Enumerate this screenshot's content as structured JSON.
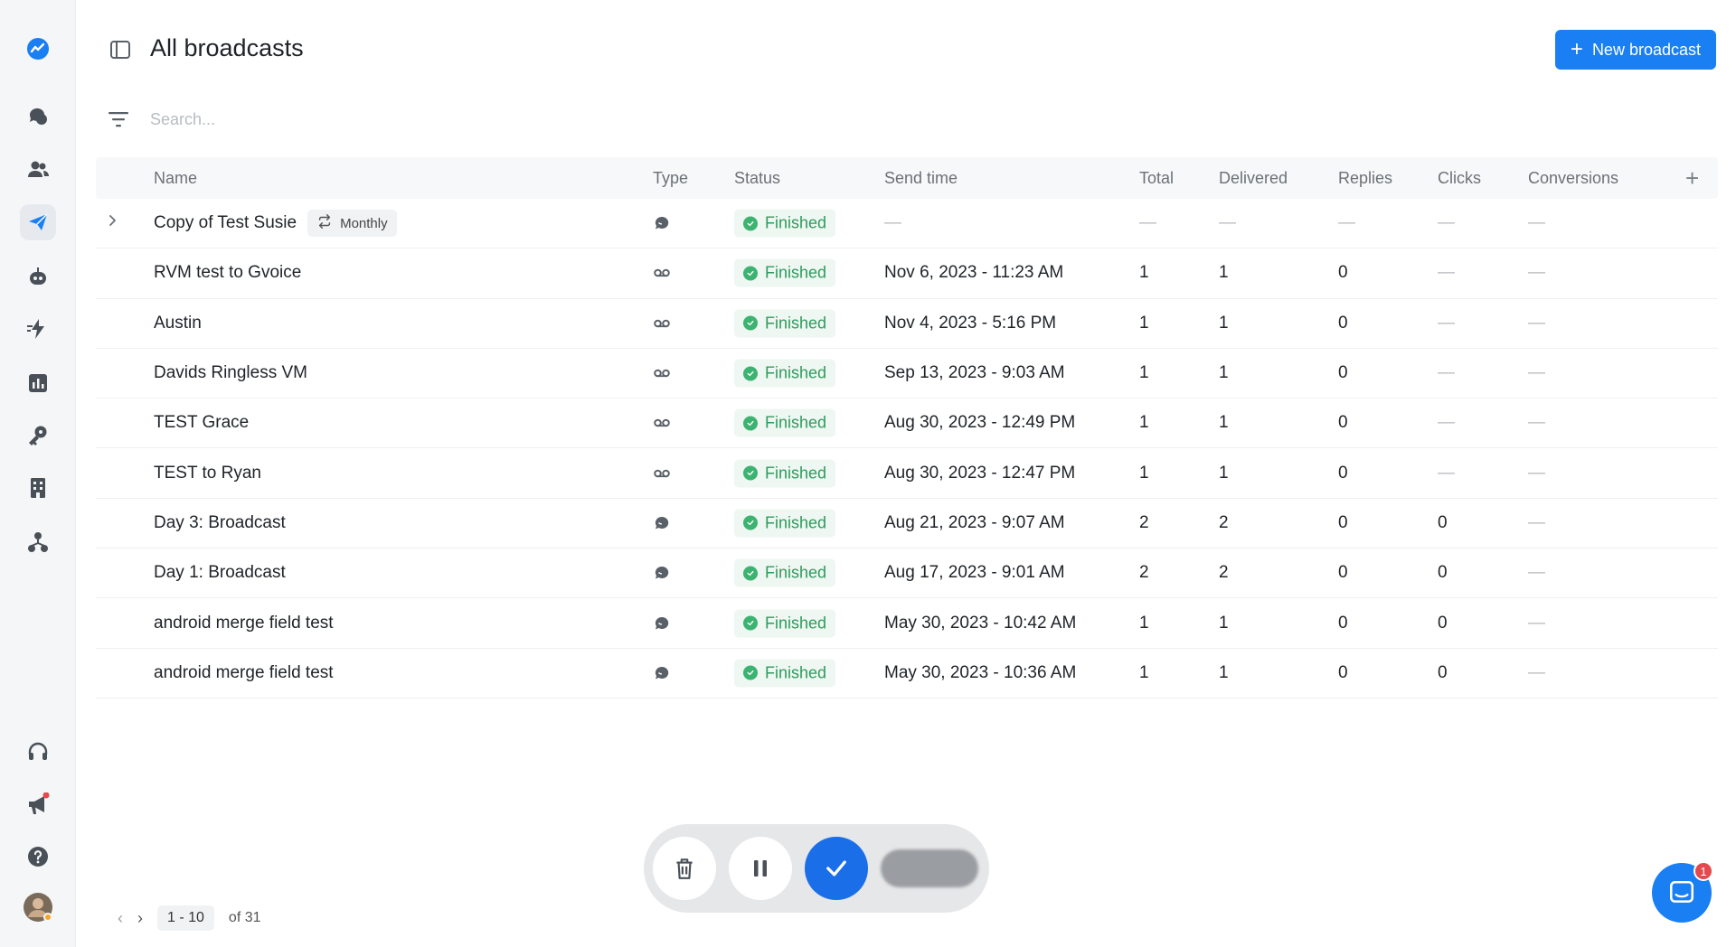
{
  "sidebar": {
    "icons": [
      "logo-icon",
      "conversations-icon",
      "contacts-icon",
      "broadcasts-icon",
      "bot-icon",
      "automations-icon",
      "reports-icon",
      "integrations-icon",
      "company-icon",
      "org-chart-icon",
      "support-icon",
      "announcements-icon",
      "help-icon",
      "user-avatar"
    ],
    "accent": "#1a7ff3"
  },
  "header": {
    "title": "All broadcasts",
    "new_button": "New broadcast"
  },
  "search": {
    "placeholder": "Search..."
  },
  "columns": {
    "name": "Name",
    "type": "Type",
    "status": "Status",
    "send_time": "Send time",
    "total": "Total",
    "delivered": "Delivered",
    "replies": "Replies",
    "clicks": "Clicks",
    "conversions": "Conversions"
  },
  "rows": [
    {
      "name": "Copy of Test Susie",
      "tag": "Monthly",
      "type": "sms",
      "status": "Finished",
      "send": "—",
      "total": "—",
      "delivered": "—",
      "replies": "—",
      "clicks": "—",
      "conversions": "—"
    },
    {
      "name": "RVM test to Gvoice",
      "type": "voicemail",
      "status": "Finished",
      "send": "Nov 6, 2023 - 11:23 AM",
      "total": "1",
      "delivered": "1",
      "replies": "0",
      "clicks": "—",
      "conversions": "—"
    },
    {
      "name": "Austin",
      "type": "voicemail",
      "status": "Finished",
      "send": "Nov 4, 2023 - 5:16 PM",
      "total": "1",
      "delivered": "1",
      "replies": "0",
      "clicks": "—",
      "conversions": "—"
    },
    {
      "name": "Davids Ringless VM",
      "type": "voicemail",
      "status": "Finished",
      "send": "Sep 13, 2023 - 9:03 AM",
      "total": "1",
      "delivered": "1",
      "replies": "0",
      "clicks": "—",
      "conversions": "—"
    },
    {
      "name": "TEST Grace",
      "type": "voicemail",
      "status": "Finished",
      "send": "Aug 30, 2023 - 12:49 PM",
      "total": "1",
      "delivered": "1",
      "replies": "0",
      "clicks": "—",
      "conversions": "—"
    },
    {
      "name": "TEST to Ryan",
      "type": "voicemail",
      "status": "Finished",
      "send": "Aug 30, 2023 - 12:47 PM",
      "total": "1",
      "delivered": "1",
      "replies": "0",
      "clicks": "—",
      "conversions": "—"
    },
    {
      "name": "Day 3: Broadcast",
      "type": "sms",
      "status": "Finished",
      "send": "Aug 21, 2023 - 9:07 AM",
      "total": "2",
      "delivered": "2",
      "replies": "0",
      "clicks": "0",
      "conversions": "—"
    },
    {
      "name": "Day 1: Broadcast",
      "type": "sms",
      "status": "Finished",
      "send": "Aug 17, 2023 - 9:01 AM",
      "total": "2",
      "delivered": "2",
      "replies": "0",
      "clicks": "0",
      "conversions": "—"
    },
    {
      "name": "android merge field test",
      "type": "sms",
      "status": "Finished",
      "send": "May 30, 2023 - 10:42 AM",
      "total": "1",
      "delivered": "1",
      "replies": "0",
      "clicks": "0",
      "conversions": "—"
    },
    {
      "name": "android merge field test",
      "type": "sms",
      "status": "Finished",
      "send": "May 30, 2023 - 10:36 AM",
      "total": "1",
      "delivered": "1",
      "replies": "0",
      "clicks": "0",
      "conversions": "—"
    }
  ],
  "pagination": {
    "range": "1 - 10",
    "total": "of 31"
  },
  "chat": {
    "badge": "1"
  },
  "colors": {
    "success": "#3cb371",
    "primary": "#1a7ff3"
  }
}
